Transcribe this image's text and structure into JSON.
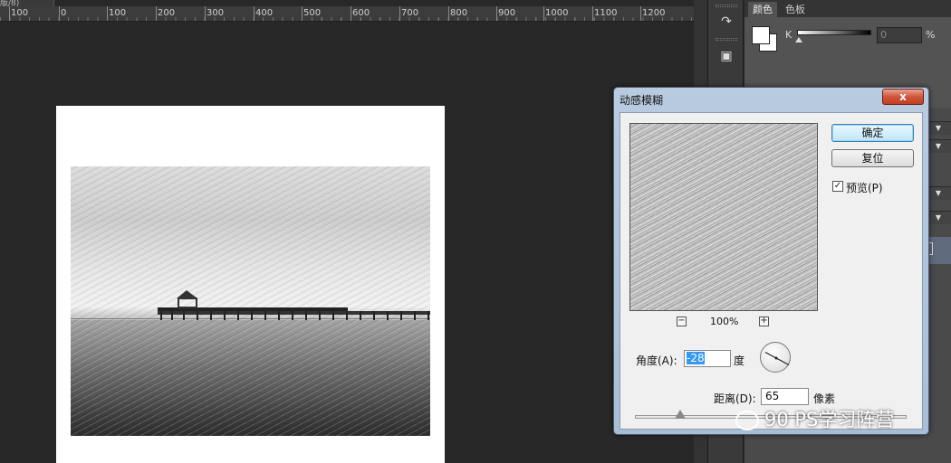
{
  "document_tab": {
    "label": "版/8)"
  },
  "ruler": {
    "ticks": [
      "100",
      "0",
      "100",
      "200",
      "300",
      "400",
      "500",
      "600",
      "700",
      "800",
      "900",
      "1000",
      "1100",
      "1200"
    ]
  },
  "color_panel": {
    "tabs": [
      "颜色",
      "色板"
    ],
    "channel_label": "K",
    "channel_value": "0",
    "percent": "%"
  },
  "dialog": {
    "title": "动感模糊",
    "close": "x",
    "ok": "确定",
    "reset": "复位",
    "preview_label": "预览(P)",
    "preview_checked": true,
    "zoom": "100%",
    "zoom_out": "−",
    "zoom_in": "+",
    "angle_label": "角度(A):",
    "angle_value": "-28",
    "angle_unit": "度",
    "distance_label": "距离(D):",
    "distance_value": "65",
    "distance_unit": "像素"
  },
  "watermark": "90 PS学习阵营",
  "icons": {
    "side_tool_1": "history-brush-icon",
    "side_tool_2": "3d-cube-icon"
  }
}
